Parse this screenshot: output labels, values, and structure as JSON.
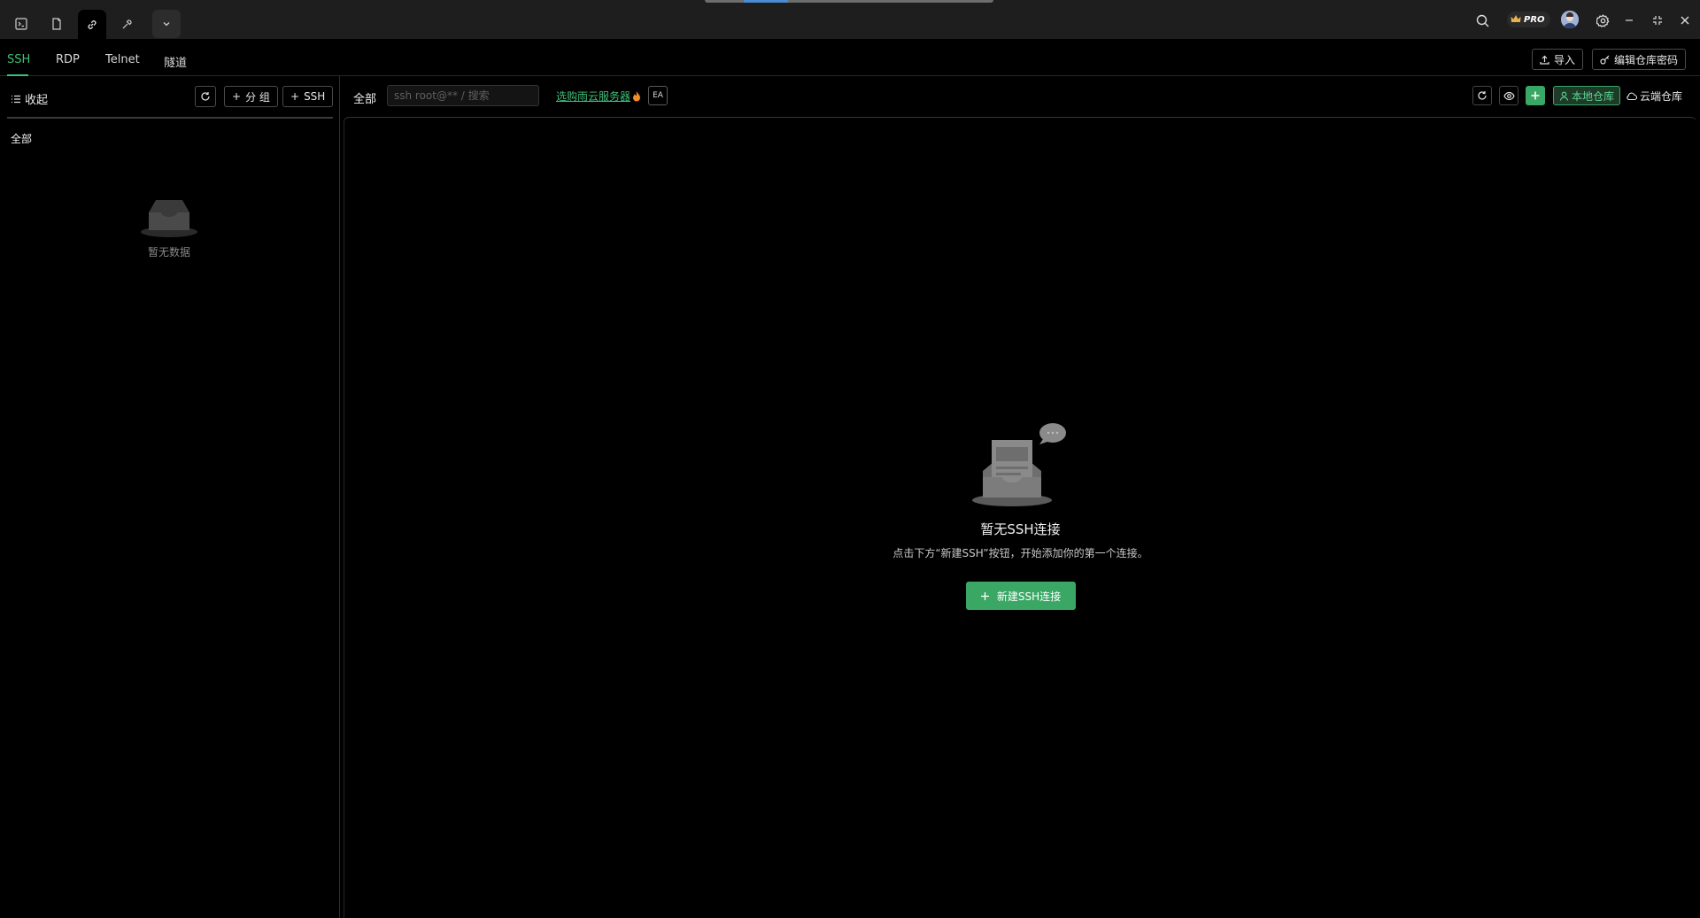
{
  "titlebar": {
    "tabs": [
      {
        "icon": "terminal-icon",
        "active": false
      },
      {
        "icon": "file-icon",
        "active": false
      },
      {
        "icon": "link-icon",
        "active": true
      },
      {
        "icon": "tools-icon",
        "active": false
      },
      {
        "icon": "chevron-down-icon",
        "active": false
      }
    ],
    "pro_badge": "PRO"
  },
  "protocol_tabs": [
    "SSH",
    "RDP",
    "Telnet",
    "隧道"
  ],
  "protocol_active": "SSH",
  "header_actions": {
    "import_label": "导入",
    "edit_password_label": "编辑仓库密码"
  },
  "sidebar": {
    "collapse_label": "收起",
    "group_button_label": "分 组",
    "ssh_button_label": "SSH",
    "all_label": "全部",
    "empty_text": "暂无数据"
  },
  "main": {
    "all_label": "全部",
    "search_placeholder": "ssh root@** / 搜索",
    "promo_link": "选购雨云服务器",
    "ai_label": "EA",
    "local_repo_label": "本地仓库",
    "cloud_repo_label": "云端仓库",
    "empty_title": "暂无SSH连接",
    "empty_desc": "点击下方“新建SSH”按钮，开始添加你的第一个连接。",
    "new_button_label": "新建SSH连接"
  },
  "colors": {
    "accent": "#3fbf78",
    "button_green": "#3aa765",
    "titlebar_bg": "#1e1e1e",
    "background": "#000000"
  }
}
